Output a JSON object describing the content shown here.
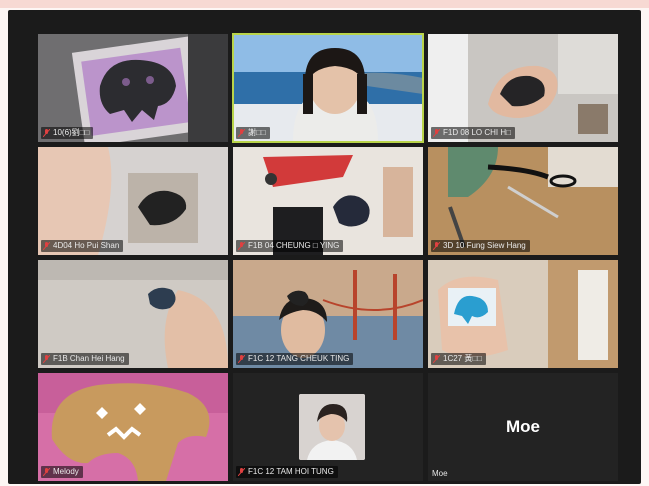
{
  "meeting": {
    "participants": [
      {
        "label": "10(6)劉□□",
        "scene": "purple-craft"
      },
      {
        "label": "謝□□",
        "scene": "teacher-sea"
      },
      {
        "label": "F1D 08 LO CHI H□",
        "scene": "hand-shape"
      },
      {
        "label": "4D04 Ho Pui Shan",
        "scene": "hand-hole"
      },
      {
        "label": "F1B 04 CHEUNG □ YING",
        "scene": "room-shape"
      },
      {
        "label": "3D 10 Fung Siew Hang",
        "scene": "scissors"
      },
      {
        "label": "F1B Chan Hei Hang",
        "scene": "paper-hand"
      },
      {
        "label": "F1C 12 TANG CHEUK TING",
        "scene": "golden-gate"
      },
      {
        "label": "1C27 黃□□",
        "scene": "blue-card"
      },
      {
        "label": "Melody",
        "scene": "cardboard-face"
      },
      {
        "label": "F1C 12 TAM HOI TUNG",
        "scene": "avatar-tile"
      },
      {
        "label": "Moe",
        "scene": "name-only",
        "display_name": "Moe"
      }
    ]
  },
  "colors": {
    "active_speaker_border": "#b9d44a",
    "muted_icon": "#e04040",
    "background": "#1b1b1b"
  },
  "icons": {
    "muted": "mic-muted-icon"
  }
}
